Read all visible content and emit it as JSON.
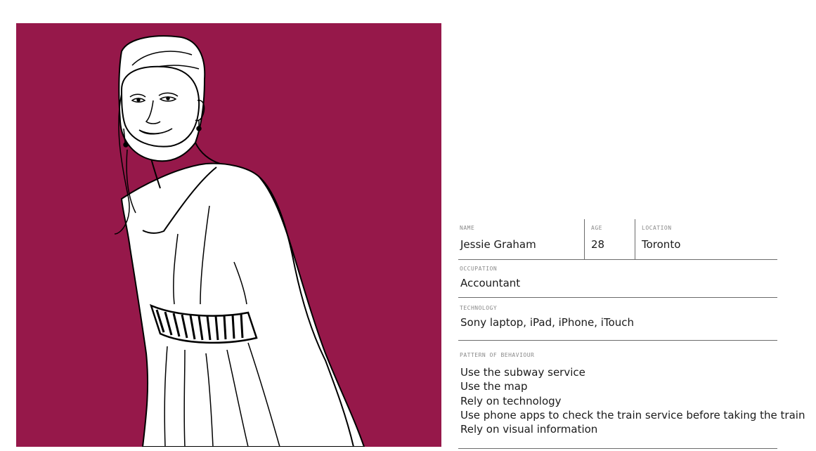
{
  "colors": {
    "portrait_background": "#96184a",
    "line_art": "#000000",
    "figure_fill": "#ffffff",
    "divider": "#6b6b6b",
    "label_text": "#8a8a8a",
    "value_text": "#1a1a1a"
  },
  "persona": {
    "name_label": "NAME",
    "name": "Jessie Graham",
    "age_label": "AGE",
    "age": "28",
    "location_label": "LOCATION",
    "location": "Toronto",
    "occupation_label": "OCCUPATION",
    "occupation": "Accountant",
    "technology_label": "TECHNOLOGY",
    "technology": "Sony laptop, iPad, iPhone, iTouch",
    "behaviour_label": "PATTERN OF BEHAVIOUR",
    "behaviours": [
      "Use the subway service",
      "Use the map",
      "Rely on technology",
      "Use phone apps to check the train service before taking the train",
      "Rely on visual information"
    ]
  }
}
